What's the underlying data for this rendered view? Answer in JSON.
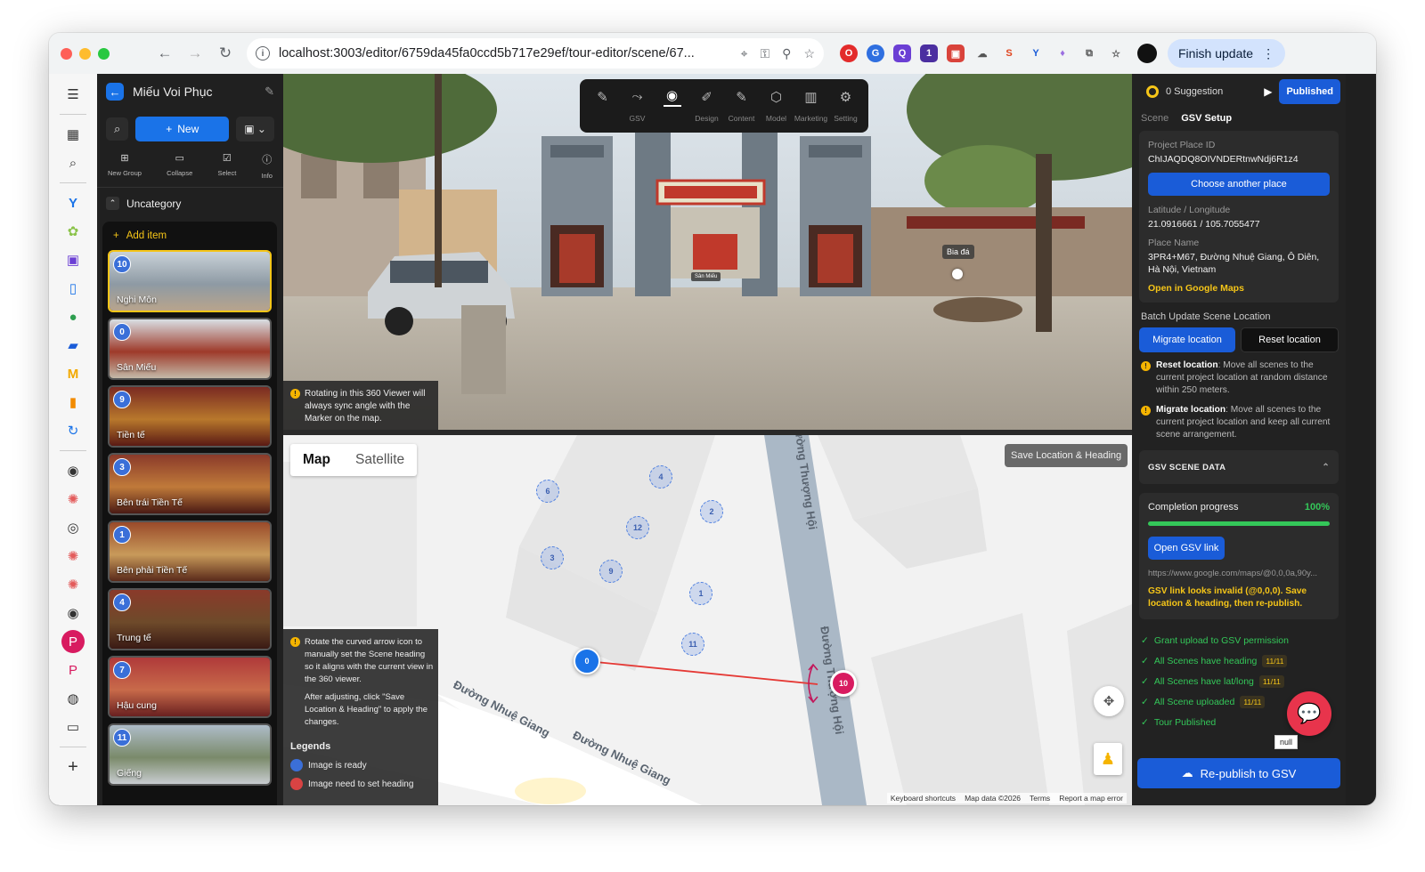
{
  "browser": {
    "url": "localhost:3003/editor/6759da45fa0ccd5b717e29ef/tour-editor/scene/67...",
    "finish_update_label": "Finish update"
  },
  "project": {
    "title": "Miếu Voi Phục",
    "new_label": "New",
    "mini_tools": [
      "New Group",
      "Collapse",
      "Select",
      "Info"
    ],
    "category": "Uncategory",
    "add_item": "Add item"
  },
  "scenes": [
    {
      "num": "10",
      "label": "Nghi Môn"
    },
    {
      "num": "0",
      "label": "Sân Miếu"
    },
    {
      "num": "9",
      "label": "Tiền tế"
    },
    {
      "num": "3",
      "label": "Bên trái Tiền Tế"
    },
    {
      "num": "1",
      "label": "Bên phải Tiền Tế"
    },
    {
      "num": "4",
      "label": "Trung tế"
    },
    {
      "num": "7",
      "label": "Hậu cung"
    },
    {
      "num": "11",
      "label": "Giếng"
    }
  ],
  "editor_tabs": [
    "",
    "GSV",
    "",
    "Design",
    "Content",
    "Model",
    "Marketing",
    "Setting"
  ],
  "viewer": {
    "hotspot_1": "Bia đá",
    "hotspot_2": "Sân Miếu",
    "note": "Rotating in this 360 Viewer will always sync angle with the Marker on the map."
  },
  "map": {
    "tab_map": "Map",
    "tab_satellite": "Satellite",
    "save_button": "Save Location & Heading",
    "markers": [
      "6",
      "4",
      "2",
      "12",
      "3",
      "9",
      "1",
      "11",
      "0",
      "10"
    ],
    "street_1": "Đường Nhuệ Giang",
    "street_2": "Đường Nhuệ Giang",
    "street_3": "Đường Thượng Hội",
    "street_4": "Đường Thượng Hội",
    "attribution": [
      "Keyboard shortcuts",
      "Map data ©2026",
      "Terms",
      "Report a map error"
    ],
    "legend_note": "Rotate the curved arrow icon to manually set the Scene heading so it aligns with the current view in the 360 viewer.",
    "legend_note_2": "After adjusting, click \"Save Location & Heading\" to apply the changes.",
    "legend_title": "Legends",
    "legend_ready": "Image is ready",
    "legend_need": "Image need to set heading"
  },
  "panel": {
    "suggestion": "0 Suggestion",
    "published": "Published",
    "tab_scene": "Scene",
    "tab_gsv": "GSV Setup",
    "place_id_label": "Project Place ID",
    "place_id": "ChIJAQDQ8OIVNDERtnwNdj6R1z4",
    "choose_place": "Choose another place",
    "latlng_label": "Latitude / Longitude",
    "latlng": "21.0916661 / 105.7055477",
    "place_name_label": "Place Name",
    "place_name": "3PR4+M67, Đường Nhuệ Giang, Ô Diên, Hà Nội, Vietnam",
    "open_maps": "Open in Google Maps",
    "batch_label": "Batch Update Scene Location",
    "migrate": "Migrate location",
    "reset": "Reset location",
    "reset_title": "Reset location",
    "reset_desc": ": Move all scenes to the current project location at random distance within 250 meters.",
    "migrate_title": "Migrate location",
    "migrate_desc": ": Move all scenes to the current project location and keep all current scene arrangement.",
    "scene_data": "GSV SCENE DATA",
    "completion": "Completion progress",
    "completion_pct": "100%",
    "completion_value": 1.0,
    "open_gsv": "Open GSV link",
    "gsv_url": "https://www.google.com/maps/@0,0,0a,90y...",
    "gsv_warn": "GSV link looks invalid (@0,0,0). Save location & heading, then re-publish.",
    "checks": [
      {
        "label": "Grant upload to GSV permission",
        "count": ""
      },
      {
        "label": "All Scenes have heading",
        "count": "11/11"
      },
      {
        "label": "All Scenes have lat/long",
        "count": "11/11"
      },
      {
        "label": "All Scene uploaded",
        "count": "11/11"
      },
      {
        "label": "Tour Published",
        "count": ""
      }
    ],
    "republish": "Re-publish to GSV",
    "null_tag": "null"
  },
  "colors": {
    "accent": "#1a5cd8",
    "success": "#34c759",
    "warning": "#f5c518",
    "pin": "#d81b60"
  }
}
